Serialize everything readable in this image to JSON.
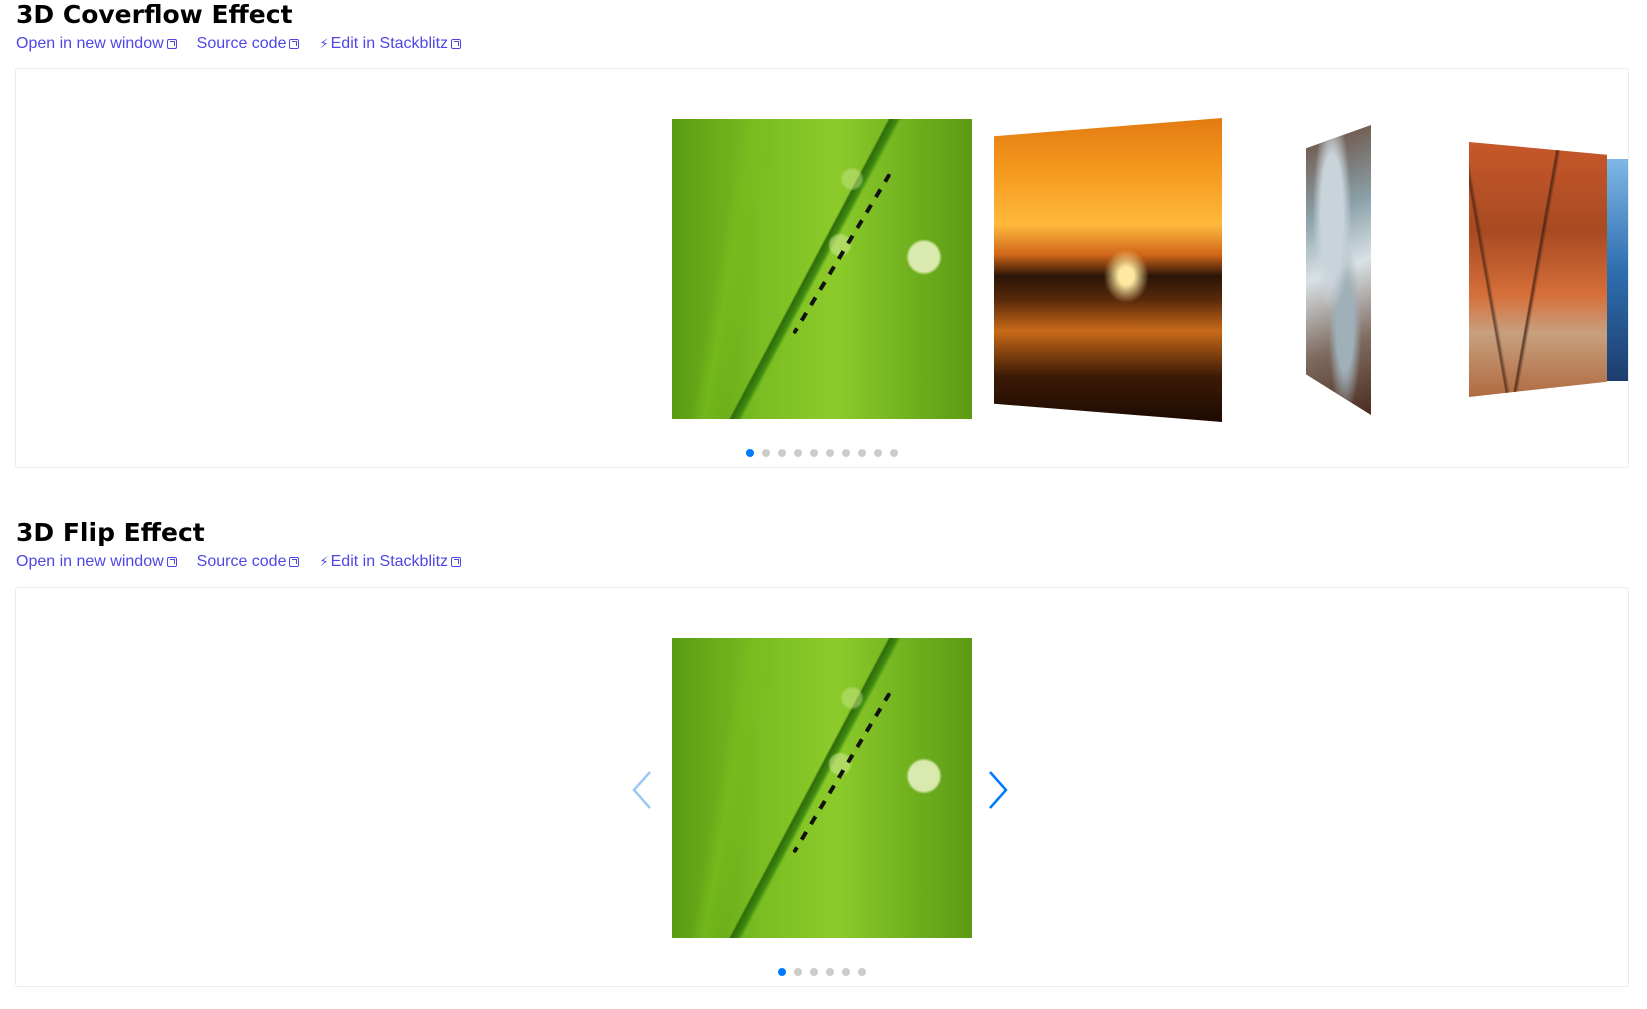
{
  "demos": [
    {
      "title": "3D Coverflow Effect",
      "links": {
        "open_new_window": "Open in new window",
        "source_code": "Source code",
        "edit_stackblitz": "Edit in Stackblitz"
      },
      "pagination": {
        "total": 10,
        "active": 1
      }
    },
    {
      "title": "3D Flip Effect",
      "links": {
        "open_new_window": "Open in new window",
        "source_code": "Source code",
        "edit_stackblitz": "Edit in Stackblitz"
      },
      "pagination": {
        "total": 6,
        "active": 1
      },
      "navigation": {
        "prev_state": "disabled",
        "next_state": "enabled"
      }
    }
  ],
  "colors": {
    "link": "#4f46e5",
    "accent": "#007aff",
    "frame_border": "#ececec"
  },
  "icons": {
    "external_link": "external-link-icon",
    "bolt": "bolt-icon",
    "prev": "chevron-left-icon",
    "next": "chevron-right-icon"
  }
}
